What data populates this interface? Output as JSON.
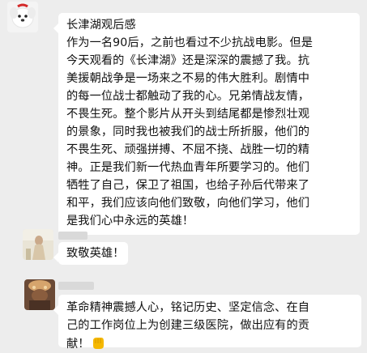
{
  "messages": [
    {
      "sender": "contact-1",
      "lines": [
        "长津湖观后感",
        "作为一名90后，之前也看过不少抗战电影。但是",
        "今天观看的《长津湖》还是深深的震撼了我。抗",
        "美援朝战争是一场来之不易的伟大胜利。剧情中",
        "的每一位战士都触动了我的心。兄弟情战友情，",
        "不畏生死。整个影片从开头到结尾都是惨烈壮观",
        "的景象，同时我也被我们的战士所折服，他们的",
        "不畏生死、顽强拼搏、不屈不挠、战胜一切的精",
        "神。正是我们新一代热血青年所要学习的。他们",
        "牺牲了自己，保卫了祖国，也给子孙后代带来了",
        "和平，我们应该向他们致敬，向他们学习，他们",
        "是我们心中永远的英雄！"
      ]
    },
    {
      "sender": "contact-2",
      "lines": [
        "致敬英雄！"
      ]
    },
    {
      "sender": "contact-3",
      "lines": [
        "革命精神震撼人心，铭记历史、坚定信念、在自",
        "己的工作岗位上为创建三级医院，做出应有的贡",
        "献！"
      ],
      "trailing_emoji": "strong-fist-emoji"
    }
  ],
  "colors": {
    "background": "#ededed",
    "bubble": "#ffffff",
    "text": "#111111",
    "emoji": "#f5b800"
  }
}
